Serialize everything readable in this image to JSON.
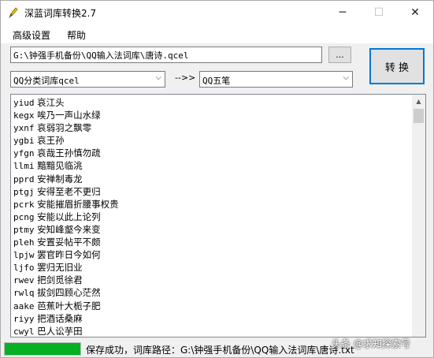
{
  "window": {
    "title": "深蓝词库转换2.7",
    "icon": "pencil-app-icon",
    "controls": {
      "minimize": "─",
      "maximize": "☐",
      "close": "✕"
    }
  },
  "menu": [
    "高级设置",
    "帮助"
  ],
  "path_input": {
    "value": "G:\\钟强手机备份\\QQ输入法词库\\唐诗.qcel"
  },
  "browse_label": "...",
  "convert_label": "转 换",
  "source_format": "QQ分类词库qcel",
  "arrow_text": "-->>",
  "target_format": "QQ五笔",
  "dropdown_arrow": "⌵",
  "entries": [
    {
      "code": "yiud",
      "word": "哀江头"
    },
    {
      "code": "kegx",
      "word": "唉乃一声山水绿"
    },
    {
      "code": "yxnf",
      "word": "哀弱羽之飘零"
    },
    {
      "code": "ygbi",
      "word": "哀王孙"
    },
    {
      "code": "yfgn",
      "word": "哀哉王孙慎勿疏"
    },
    {
      "code": "llmi",
      "word": "黯黯见临洮"
    },
    {
      "code": "pprd",
      "word": "安禅制毒龙"
    },
    {
      "code": "ptgj",
      "word": "安得至老不更归"
    },
    {
      "code": "pcrk",
      "word": "安能摧眉折腰事权贵"
    },
    {
      "code": "pcng",
      "word": "安能以此上论列"
    },
    {
      "code": "ptmy",
      "word": "安知峰壑今来变"
    },
    {
      "code": "pleh",
      "word": "安置妥帖平不颇"
    },
    {
      "code": "lpjw",
      "word": "罢官昨日今如何"
    },
    {
      "code": "ljfo",
      "word": "罢归无旧业"
    },
    {
      "code": "rwev",
      "word": "把剑觅徐君"
    },
    {
      "code": "rwlq",
      "word": "拔剑四顾心茫然"
    },
    {
      "code": "aake",
      "word": "芭蕉叶大栀子肥"
    },
    {
      "code": "riyy",
      "word": "把酒话桑麻"
    },
    {
      "code": "cwyl",
      "word": "巴人讼芋田"
    }
  ],
  "progress": {
    "value": 1.0,
    "color": "#06b025"
  },
  "status": "保存成功，词库路径：G:\\钟强手机备份\\QQ输入法词库\\唐诗.txt",
  "watermark": "头条 @求知探索号"
}
